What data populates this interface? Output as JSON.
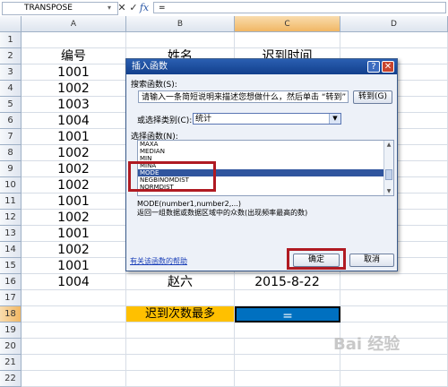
{
  "formula_bar": {
    "name_box": "TRANSPOSE",
    "cancel_icon": "✕",
    "enter_icon": "✓",
    "fx_label": "fx",
    "formula": "="
  },
  "columns": [
    "A",
    "B",
    "C",
    "D"
  ],
  "rows": [
    {
      "num": "1",
      "cells": [
        "",
        "",
        "",
        ""
      ]
    },
    {
      "num": "2",
      "cells": [
        "编号",
        "姓名",
        "迟到时间",
        ""
      ]
    },
    {
      "num": "3",
      "cells": [
        "1001",
        "",
        "",
        ""
      ]
    },
    {
      "num": "4",
      "cells": [
        "1002",
        "",
        "",
        ""
      ]
    },
    {
      "num": "5",
      "cells": [
        "1003",
        "",
        "",
        ""
      ]
    },
    {
      "num": "6",
      "cells": [
        "1004",
        "",
        "",
        ""
      ]
    },
    {
      "num": "7",
      "cells": [
        "1001",
        "",
        "",
        ""
      ]
    },
    {
      "num": "8",
      "cells": [
        "1002",
        "",
        "",
        ""
      ]
    },
    {
      "num": "9",
      "cells": [
        "1002",
        "",
        "",
        ""
      ]
    },
    {
      "num": "10",
      "cells": [
        "1002",
        "",
        "",
        ""
      ]
    },
    {
      "num": "11",
      "cells": [
        "1001",
        "",
        "",
        ""
      ]
    },
    {
      "num": "12",
      "cells": [
        "1002",
        "",
        "",
        ""
      ]
    },
    {
      "num": "13",
      "cells": [
        "1001",
        "",
        "",
        ""
      ]
    },
    {
      "num": "14",
      "cells": [
        "1002",
        "",
        "",
        ""
      ]
    },
    {
      "num": "15",
      "cells": [
        "1001",
        "",
        "",
        ""
      ]
    },
    {
      "num": "16",
      "cells": [
        "1004",
        "赵六",
        "2015-8-22",
        ""
      ]
    },
    {
      "num": "17",
      "cells": [
        "",
        "",
        "",
        ""
      ]
    },
    {
      "num": "18",
      "cells": [
        "",
        "迟到次数最多",
        "=",
        ""
      ]
    },
    {
      "num": "19",
      "cells": [
        "",
        "",
        "",
        ""
      ]
    },
    {
      "num": "20",
      "cells": [
        "",
        "",
        "",
        ""
      ]
    },
    {
      "num": "21",
      "cells": [
        "",
        "",
        "",
        ""
      ]
    },
    {
      "num": "22",
      "cells": [
        "",
        "",
        "",
        ""
      ]
    }
  ],
  "colors": {
    "highlight_label": "#ffc000",
    "active_cell": "#0070c0",
    "dialog_title": "#1f4f9e",
    "selection": "#30559e",
    "annotation_box": "#b01a22"
  },
  "dialog": {
    "title": "插入函数",
    "help_button": "?",
    "close_button": "✕",
    "search_label": "搜索函数(S):",
    "search_value": "请输入一条简短说明来描述您想做什么，然后单击 “转到”",
    "go_button": "转到(G)",
    "category_label": "或选择类别(C):",
    "category_value": "统计",
    "function_list_label": "选择函数(N):",
    "functions": [
      "MAXA",
      "MEDIAN",
      "MIN",
      "MINA",
      "MODE",
      "NEGBINOMDIST",
      "NORMDIST"
    ],
    "selected_function": "MODE",
    "signature": "MODE(number1,number2,...)",
    "description": "返回一组数据或数据区域中的众数(出现频率最高的数)",
    "help_link": "有关该函数的帮助",
    "ok_button": "确定",
    "cancel_button": "取消"
  },
  "watermark": "Bai 经验"
}
